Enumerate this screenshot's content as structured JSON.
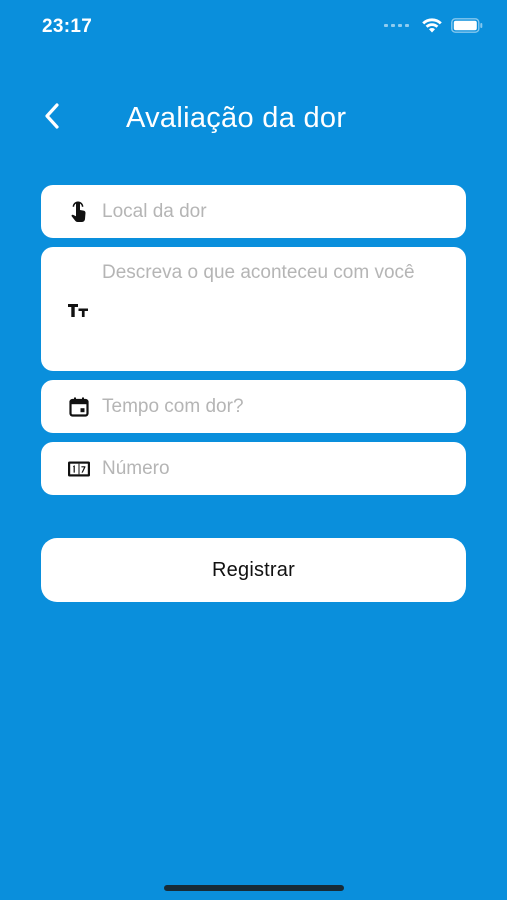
{
  "status_bar": {
    "time": "23:17",
    "icons": [
      "signal-icon",
      "wifi-icon",
      "battery-icon"
    ]
  },
  "header": {
    "title": "Avaliação da dor",
    "back_icon": "chevron-left-icon"
  },
  "form": {
    "local": {
      "placeholder": "Local da dor",
      "value": "",
      "icon": "touch-hand-icon"
    },
    "descricao": {
      "placeholder": "Descreva o que aconteceu com você",
      "value": "",
      "icon": "text-format-icon"
    },
    "tempo": {
      "placeholder": "Tempo com dor?",
      "value": "",
      "icon": "calendar-icon"
    },
    "numero": {
      "placeholder": "Número",
      "value": "",
      "icon": "number-box-icon"
    }
  },
  "actions": {
    "register_label": "Registrar"
  },
  "colors": {
    "background": "#0a8fdc",
    "card": "#ffffff",
    "placeholder": "#b5b5b5"
  }
}
